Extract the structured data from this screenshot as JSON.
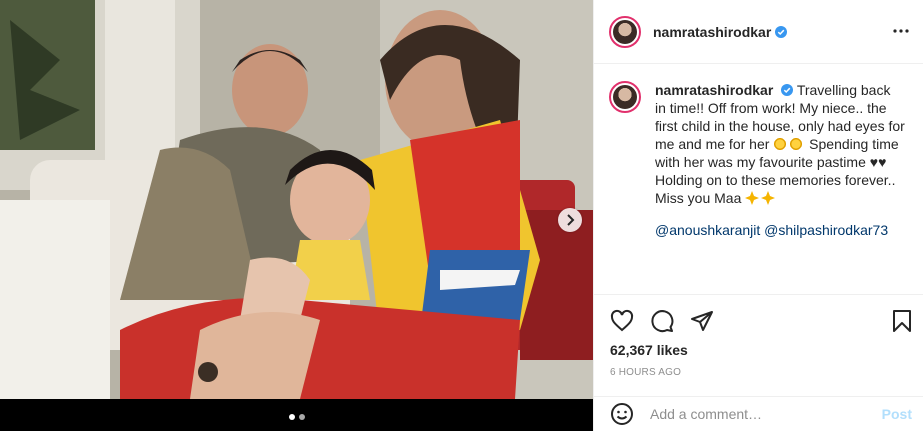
{
  "post": {
    "username": "namratashirodkar",
    "verified": true,
    "media_count": 2,
    "current_media": 1
  },
  "caption": {
    "username": "namratashirodkar",
    "text_1": "Travelling back in time!! Off from work! My niece.. the first child in the house, only had eyes for me and me for her",
    "text_2": "Spending time with her was my favourite pastime",
    "hearts": "♥♥",
    "text_3": "Holding on to these memories forever.. Miss you Maa",
    "mentions": [
      "@anoushkaranjit",
      "@shilpashirodkar73"
    ]
  },
  "stats": {
    "likes": "62,367 likes",
    "time": "6 HOURS AGO"
  },
  "comment": {
    "placeholder": "Add a comment…",
    "post_label": "Post"
  },
  "icons": {
    "more": "more-horizontal-icon",
    "like": "heart-icon",
    "comment": "comment-bubble-icon",
    "share": "paper-plane-icon",
    "save": "bookmark-icon",
    "emoji": "smiley-icon",
    "next": "chevron-right-icon"
  },
  "colors": {
    "verified": "#3897f0",
    "link": "#00376b",
    "post_disabled": "#b2dffc",
    "muted": "#8e8e8e",
    "story_ring": "#e1306c"
  }
}
